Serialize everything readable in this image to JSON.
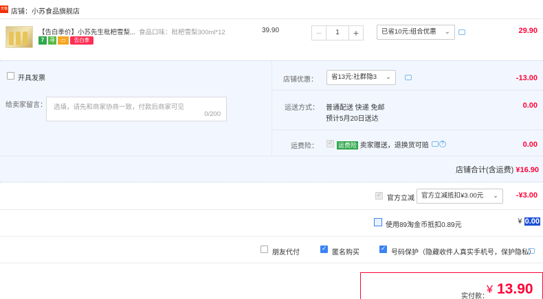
{
  "shop": {
    "badge": "天猫",
    "label": "店铺：小苏食品旗舰店"
  },
  "item": {
    "title": "【告白季价】小苏先生枇杷雪梨...",
    "sku": "食品口味：枇杷雪梨300ml*12",
    "tags": {
      "seven": "7",
      "green": "寻",
      "season": "告白季"
    },
    "unit_price": "39.90",
    "quantity": "1",
    "minus": "−",
    "plus": "+",
    "promo_select": "已省10元:组合优惠",
    "line_total": "29.90"
  },
  "invoice": {
    "label": "开具发票"
  },
  "memo": {
    "label": "给卖家留言：",
    "placeholder": "选填，请先和商家协商一致，付款后商家可见",
    "count": "0/200"
  },
  "shop_discount": {
    "label": "店铺优惠：",
    "select": "省13元:社群隐3",
    "amount": "-13.00"
  },
  "shipping": {
    "label": "运送方式：",
    "method": "普通配送 快递 免邮",
    "estimate": "预计5月20日送达",
    "amount": "0.00"
  },
  "freight_insurance": {
    "label": "运费险：",
    "tag": "运费险",
    "desc": "卖家赠送，退换货可赔",
    "amount": "0.00"
  },
  "shop_total": {
    "label": "店铺合计(含运费)",
    "value": "¥16.90"
  },
  "official_discount": {
    "label": "官方立减",
    "select": "官方立减抵扣¥3.00元",
    "amount": "-¥3.00"
  },
  "taojinbi": {
    "label": "使用89淘金币抵扣0.89元",
    "currency": "¥",
    "value": "0.00"
  },
  "options": {
    "friend_pay": "朋友代付",
    "anonymous": "匿名购买",
    "phone_protect": "号码保护（隐藏收件人真实手机号，保护隐私）"
  },
  "pay": {
    "label": "实付款：",
    "currency": "¥",
    "amount": "13.90"
  },
  "colors": {
    "accent_red": "#ff0036",
    "panel_blue": "#f2f7ff",
    "checkbox_blue": "#3b82f6"
  }
}
